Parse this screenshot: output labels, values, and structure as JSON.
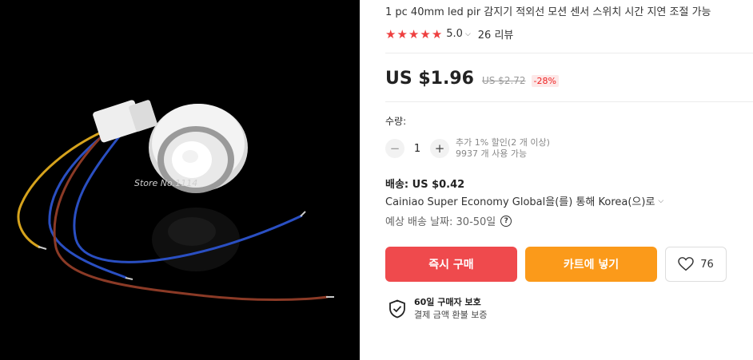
{
  "product": {
    "title": "1 pc 40mm led pir 감지기 적외선 모션 센서 스위치 시간 지연 조절 가능",
    "image_watermark": "Store No.1114"
  },
  "rating": {
    "stars": 5,
    "value": "5.0",
    "reviews": "26 리뷰",
    "star_color": "#ee3f3f"
  },
  "price": {
    "current": "US $1.96",
    "original": "US $2.72",
    "discount": "-28%"
  },
  "quantity": {
    "label": "수량:",
    "value": "1",
    "minus": "−",
    "plus": "+",
    "discount_note": "추가 1% 할인(2 개 이상)",
    "available": "9937 개 사용 가능"
  },
  "shipping": {
    "title": "배송: US $0.42",
    "method": "Cainiao Super Economy Global을(를) 통해 Korea(으)로",
    "estimate": "예상 배송 날짜: 30-50일",
    "help_icon": "?"
  },
  "actions": {
    "buy_now": "즉시 구매",
    "add_to_cart": "카트에 넣기",
    "wishlist_count": "76",
    "buy_color": "#ef4a4d",
    "cart_color": "#fb9a1a"
  },
  "protection": {
    "title": "60일 구매자 보호",
    "subtitle": "결제 금액 환불 보증"
  },
  "icons": {
    "star": "star-icon",
    "chevron": "chevron-down-icon",
    "heart": "heart-icon",
    "shield": "shield-check-icon",
    "help": "help-circle-icon"
  }
}
